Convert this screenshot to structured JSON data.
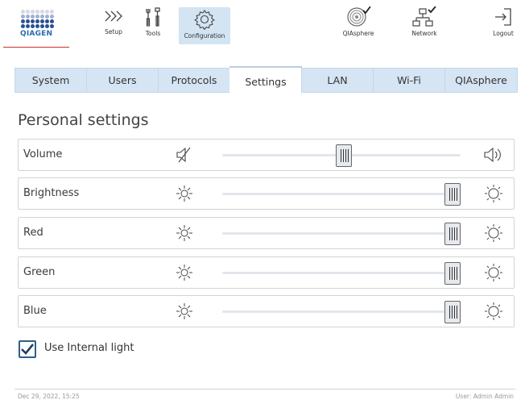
{
  "brand": {
    "name": "QIAGEN",
    "color": "#2a6cb0",
    "accent_line": "#c7312b"
  },
  "toolbar": {
    "setup_label": "Setup",
    "tools_label": "Tools",
    "configuration_label": "Configuration",
    "qiasphere_label": "QIAsphere",
    "network_label": "Network",
    "logout_label": "Logout",
    "active_button": "Configuration",
    "active_bg": "#d3e4f3"
  },
  "tabs": [
    {
      "label": "System"
    },
    {
      "label": "Users"
    },
    {
      "label": "Protocols"
    },
    {
      "label": "Settings",
      "active": true
    },
    {
      "label": "LAN"
    },
    {
      "label": "Wi-Fi"
    },
    {
      "label": "QIAsphere"
    }
  ],
  "page": {
    "title": "Personal settings"
  },
  "settings": [
    {
      "label": "Volume",
      "value_fraction": 0.51,
      "icon_low": "speaker-muted-icon",
      "icon_high": "speaker-loud-icon"
    },
    {
      "label": "Brightness",
      "value_fraction": 1.0,
      "icon_low": "sun-dim-icon",
      "icon_high": "sun-bright-icon"
    },
    {
      "label": "Red",
      "value_fraction": 1.0,
      "icon_low": "sun-dim-icon",
      "icon_high": "sun-bright-icon"
    },
    {
      "label": "Green",
      "value_fraction": 1.0,
      "icon_low": "sun-dim-icon",
      "icon_high": "sun-bright-icon"
    },
    {
      "label": "Blue",
      "value_fraction": 1.0,
      "icon_low": "sun-dim-icon",
      "icon_high": "sun-bright-icon"
    }
  ],
  "internal_light": {
    "label": "Use Internal light",
    "checked": true
  },
  "footer": {
    "datetime": "Dec 29, 2022, 15:25",
    "user": "User: Admin Admin"
  }
}
